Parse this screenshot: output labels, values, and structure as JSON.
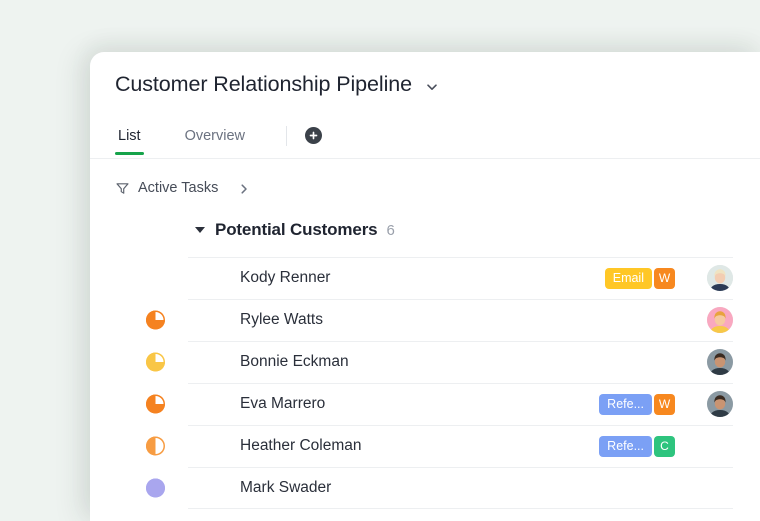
{
  "app": {
    "background_color": "#eef3f0",
    "card_background": "#ffffff"
  },
  "header": {
    "title": "Customer Relationship Pipeline",
    "title_caret_icon": "chevron-down-icon"
  },
  "tabs": {
    "items": [
      {
        "label": "List",
        "active": true
      },
      {
        "label": "Overview",
        "active": false
      }
    ],
    "add_tab_icon": "plus-icon",
    "active_underline_color": "#16a34a"
  },
  "filterbar": {
    "icon": "filter-icon",
    "label": "Active Tasks",
    "chevron_icon": "chevron-right-icon"
  },
  "section": {
    "caret_icon": "caret-down-icon",
    "title": "Potential Customers",
    "count": "6"
  },
  "rows": [
    {
      "name": "Kody Renner",
      "progress": {
        "percent": 0,
        "color": "#f58220",
        "show": false
      },
      "tag": {
        "label": "Email",
        "color": "#ffc726"
      },
      "badge": {
        "letter": "W",
        "color": "#f7881f"
      },
      "avatar": {
        "name": "avatar-kody-renner",
        "show": true,
        "hair": "#efe3c2",
        "skin": "#f3cdb2",
        "bg": "#dfe8e6",
        "shirt": "#2b3a55"
      }
    },
    {
      "name": "Rylee Watts",
      "progress": {
        "percent": 75,
        "color": "#f58220",
        "show": true
      },
      "tag": null,
      "badge": null,
      "avatar": {
        "name": "avatar-rylee-watts",
        "show": true,
        "hair": "#e8a33d",
        "skin": "#f6c9a0",
        "bg": "#f9a8c0",
        "shirt": "#f7c948"
      }
    },
    {
      "name": "Bonnie Eckman",
      "progress": {
        "percent": 75,
        "color": "#f9c646",
        "show": true
      },
      "tag": null,
      "badge": null,
      "avatar": {
        "name": "avatar-bonnie-eckman",
        "show": true,
        "hair": "#3a2b21",
        "skin": "#c99472",
        "bg": "#8b9aa3",
        "shirt": "#2f3b45"
      }
    },
    {
      "name": "Eva Marrero",
      "progress": {
        "percent": 75,
        "color": "#f58220",
        "show": true
      },
      "tag": {
        "label": "Refe...",
        "color": "#7ba0f5"
      },
      "badge": {
        "letter": "W",
        "color": "#f7881f"
      },
      "avatar": {
        "name": "avatar-eva-marrero",
        "show": true,
        "hair": "#3a2b21",
        "skin": "#c99472",
        "bg": "#8b9aa3",
        "shirt": "#2f3b45"
      }
    },
    {
      "name": "Heather Coleman",
      "progress": {
        "percent": 50,
        "color": "#f79c42",
        "show": true
      },
      "tag": {
        "label": "Refe...",
        "color": "#7ba0f5"
      },
      "badge": {
        "letter": "C",
        "color": "#2ec47e"
      },
      "avatar": {
        "name": "avatar-heather-coleman",
        "show": false
      }
    },
    {
      "name": "Mark Swader",
      "progress": {
        "percent": 100,
        "color": "#a9a6ee",
        "show": true
      },
      "tag": null,
      "badge": null,
      "avatar": {
        "name": "avatar-mark-swader",
        "show": false
      }
    }
  ]
}
